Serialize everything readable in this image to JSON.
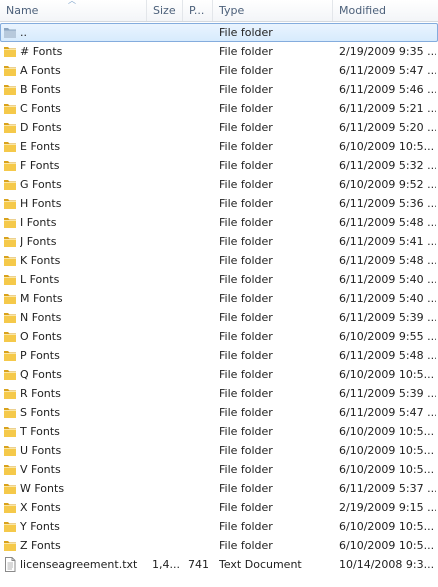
{
  "columns": {
    "name": "Name",
    "size": "Size",
    "p": "P...",
    "type": "Type",
    "modified": "Modified"
  },
  "rows": [
    {
      "name": "..",
      "size": "",
      "p": "",
      "type": "File folder",
      "modified": "",
      "icon": "up-folder-icon"
    },
    {
      "name": "# Fonts",
      "size": "",
      "p": "",
      "type": "File folder",
      "modified": "2/19/2009 9:35 ...",
      "icon": "folder-icon"
    },
    {
      "name": "A Fonts",
      "size": "",
      "p": "",
      "type": "File folder",
      "modified": "6/11/2009 5:47 ...",
      "icon": "folder-icon"
    },
    {
      "name": "B Fonts",
      "size": "",
      "p": "",
      "type": "File folder",
      "modified": "6/11/2009 5:46 ...",
      "icon": "folder-icon"
    },
    {
      "name": "C Fonts",
      "size": "",
      "p": "",
      "type": "File folder",
      "modified": "6/11/2009 5:21 ...",
      "icon": "folder-icon"
    },
    {
      "name": "D Fonts",
      "size": "",
      "p": "",
      "type": "File folder",
      "modified": "6/11/2009 5:20 ...",
      "icon": "folder-icon"
    },
    {
      "name": "E Fonts",
      "size": "",
      "p": "",
      "type": "File folder",
      "modified": "6/10/2009 10:5...",
      "icon": "folder-icon"
    },
    {
      "name": "F Fonts",
      "size": "",
      "p": "",
      "type": "File folder",
      "modified": "6/11/2009 5:32 ...",
      "icon": "folder-icon"
    },
    {
      "name": "G Fonts",
      "size": "",
      "p": "",
      "type": "File folder",
      "modified": "6/10/2009 9:52 ...",
      "icon": "folder-icon"
    },
    {
      "name": "H Fonts",
      "size": "",
      "p": "",
      "type": "File folder",
      "modified": "6/11/2009 5:36 ...",
      "icon": "folder-icon"
    },
    {
      "name": "I Fonts",
      "size": "",
      "p": "",
      "type": "File folder",
      "modified": "6/11/2009 5:48 ...",
      "icon": "folder-icon"
    },
    {
      "name": "J Fonts",
      "size": "",
      "p": "",
      "type": "File folder",
      "modified": "6/11/2009 5:41 ...",
      "icon": "folder-icon"
    },
    {
      "name": "K Fonts",
      "size": "",
      "p": "",
      "type": "File folder",
      "modified": "6/11/2009 5:48 ...",
      "icon": "folder-icon"
    },
    {
      "name": "L Fonts",
      "size": "",
      "p": "",
      "type": "File folder",
      "modified": "6/11/2009 5:40 ...",
      "icon": "folder-icon"
    },
    {
      "name": "M Fonts",
      "size": "",
      "p": "",
      "type": "File folder",
      "modified": "6/11/2009 5:40 ...",
      "icon": "folder-icon"
    },
    {
      "name": "N Fonts",
      "size": "",
      "p": "",
      "type": "File folder",
      "modified": "6/11/2009 5:39 ...",
      "icon": "folder-icon"
    },
    {
      "name": "O Fonts",
      "size": "",
      "p": "",
      "type": "File folder",
      "modified": "6/10/2009 9:55 ...",
      "icon": "folder-icon"
    },
    {
      "name": "P Fonts",
      "size": "",
      "p": "",
      "type": "File folder",
      "modified": "6/11/2009 5:48 ...",
      "icon": "folder-icon"
    },
    {
      "name": "Q Fonts",
      "size": "",
      "p": "",
      "type": "File folder",
      "modified": "6/10/2009 10:5...",
      "icon": "folder-icon"
    },
    {
      "name": "R Fonts",
      "size": "",
      "p": "",
      "type": "File folder",
      "modified": "6/11/2009 5:39 ...",
      "icon": "folder-icon"
    },
    {
      "name": "S Fonts",
      "size": "",
      "p": "",
      "type": "File folder",
      "modified": "6/11/2009 5:47 ...",
      "icon": "folder-icon"
    },
    {
      "name": "T Fonts",
      "size": "",
      "p": "",
      "type": "File folder",
      "modified": "6/10/2009 10:5...",
      "icon": "folder-icon"
    },
    {
      "name": "U Fonts",
      "size": "",
      "p": "",
      "type": "File folder",
      "modified": "6/10/2009 10:5...",
      "icon": "folder-icon"
    },
    {
      "name": "V Fonts",
      "size": "",
      "p": "",
      "type": "File folder",
      "modified": "6/10/2009 10:5...",
      "icon": "folder-icon"
    },
    {
      "name": "W Fonts",
      "size": "",
      "p": "",
      "type": "File folder",
      "modified": "6/11/2009 5:37 ...",
      "icon": "folder-icon"
    },
    {
      "name": "X Fonts",
      "size": "",
      "p": "",
      "type": "File folder",
      "modified": "2/19/2009 9:15 ...",
      "icon": "folder-icon"
    },
    {
      "name": "Y Fonts",
      "size": "",
      "p": "",
      "type": "File folder",
      "modified": "6/10/2009 10:5...",
      "icon": "folder-icon"
    },
    {
      "name": "Z Fonts",
      "size": "",
      "p": "",
      "type": "File folder",
      "modified": "6/10/2009 10:5...",
      "icon": "folder-icon"
    },
    {
      "name": "licenseagreement.txt",
      "size": "1,4...",
      "p": "741",
      "type": "Text Document",
      "modified": "10/14/2008 9:3...",
      "icon": "text-file-icon"
    }
  ],
  "selected_row": 0,
  "colors": {
    "folder": "#f5c94a",
    "folder_dark": "#d9a21c",
    "selection_border": "#84acdd",
    "header_text": "#4c607a"
  }
}
